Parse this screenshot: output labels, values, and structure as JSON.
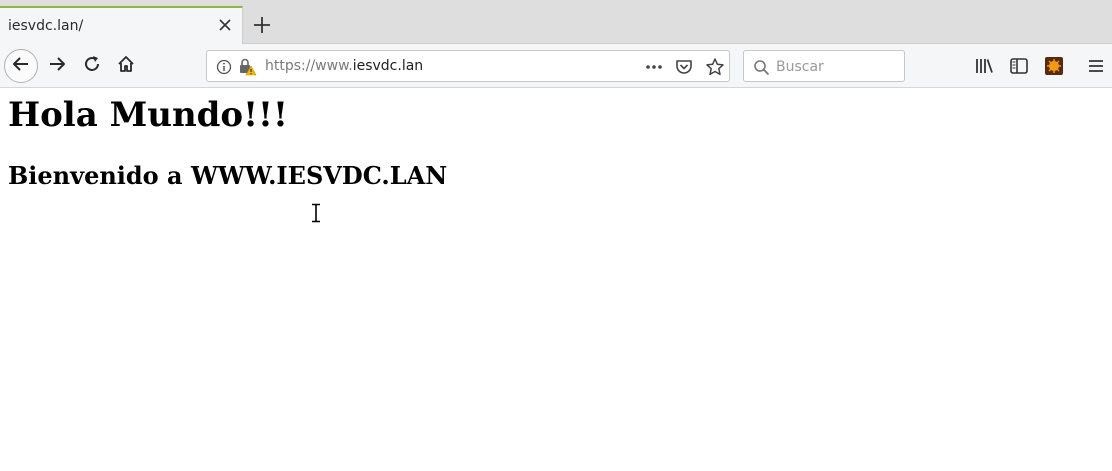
{
  "tab": {
    "title": "iesvdc.lan/",
    "close_icon": "close-icon",
    "accent": "#8bb74b"
  },
  "newtab": {
    "icon": "plus-icon"
  },
  "nav": {
    "back_icon": "back-arrow-icon",
    "forward_icon": "forward-arrow-icon",
    "reload_icon": "reload-icon",
    "home_icon": "home-icon"
  },
  "urlbar": {
    "info_icon": "info-icon",
    "lock_icon": "lock-warning-icon",
    "url_prefix": "https://www.",
    "url_host": "iesvdc.lan",
    "page_actions_icon": "more-dots-icon",
    "pocket_icon": "pocket-icon",
    "bookmark_icon": "star-icon"
  },
  "search": {
    "placeholder": "Buscar",
    "icon": "search-icon"
  },
  "toolbar_right": {
    "library_icon": "library-icon",
    "sidebar_icon": "sidebar-icon",
    "extension_icon": "extension-icon",
    "menu_icon": "hamburger-menu-icon",
    "extension_color": "#d35400"
  },
  "content": {
    "heading": "Hola Mundo!!!",
    "subheading": "Bienvenido a WWW.IESVDC.LAN"
  }
}
